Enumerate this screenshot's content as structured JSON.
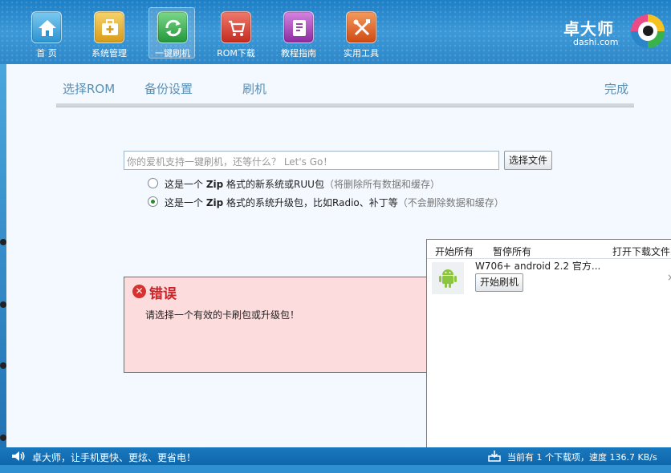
{
  "toolbar": {
    "items": [
      {
        "label": "首 页",
        "icon": "home-icon",
        "color": "#38a6dc"
      },
      {
        "label": "系统管理",
        "icon": "toolbox-icon",
        "color": "#e8b52a"
      },
      {
        "label": "一键刷机",
        "icon": "refresh-icon",
        "color": "#2fa84a",
        "active": true
      },
      {
        "label": "ROM下载",
        "icon": "cart-icon",
        "color": "#d23b2c"
      },
      {
        "label": "教程指南",
        "icon": "book-icon",
        "color": "#a03bb0"
      },
      {
        "label": "实用工具",
        "icon": "tools-icon",
        "color": "#e05a1e"
      }
    ],
    "brand": {
      "name": "卓大师",
      "domain": "dashi.com"
    }
  },
  "steps": [
    "选择ROM",
    "备份设置",
    "刷机",
    "完成"
  ],
  "rom": {
    "placeholder": "你的爱机支持一键刷机，还等什么？ Let's Go！",
    "choose_label": "选择文件"
  },
  "options": [
    {
      "pre": "这是一个 ",
      "bold": "Zip",
      "post": " 格式的新系统或RUU包",
      "note": "（将删除所有数据和缓存）",
      "selected": false
    },
    {
      "pre": "这是一个 ",
      "bold": "Zip",
      "post": " 格式的系统升级包，比如Radio、补丁等",
      "note": "（不会删除数据和缓存）",
      "selected": true
    }
  ],
  "error": {
    "title": "错误",
    "message": "请选择一个有效的卡刷包或升级包！"
  },
  "downloads": {
    "start_all": "开始所有",
    "pause_all": "暂停所有",
    "open_folder": "打开下载文件",
    "item": {
      "name": "W706+ android 2.2 官方...",
      "action": "开始刷机"
    }
  },
  "status": {
    "slogan": "卓大师，让手机更快、更炫、更省电！",
    "download_info": "当前有 1 个下载项，速度 136.7 KB/s"
  }
}
